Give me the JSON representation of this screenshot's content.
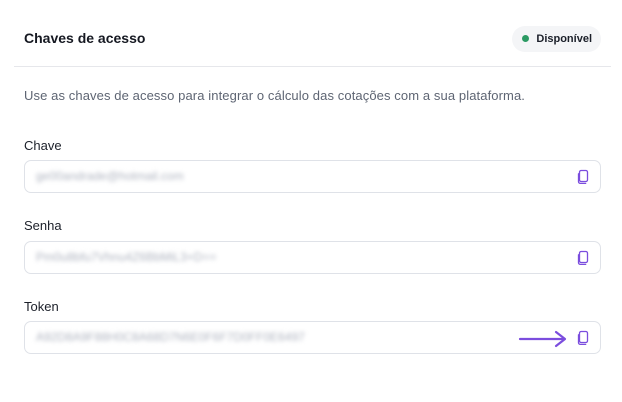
{
  "header": {
    "title": "Chaves de acesso",
    "status": "Disponível"
  },
  "description": "Use as chaves de acesso para integrar o cálculo das cotações com a sua plataforma.",
  "fields": [
    {
      "label": "Chave",
      "value": "ge00andrade@hotmail.com"
    },
    {
      "label": "Senha",
      "value": "Pm0u8bfu7Vhnu4Z6BbMiL3+D=="
    },
    {
      "label": "Token",
      "value": "A92D8A9F88H0C8A68D7N6E0F6F7D0FF0E6497"
    }
  ],
  "colors": {
    "accent": "#7b4dde",
    "status": "#2b9a63"
  },
  "icons": {
    "copy": "copy-icon",
    "arrow": "arrow-right-icon"
  }
}
